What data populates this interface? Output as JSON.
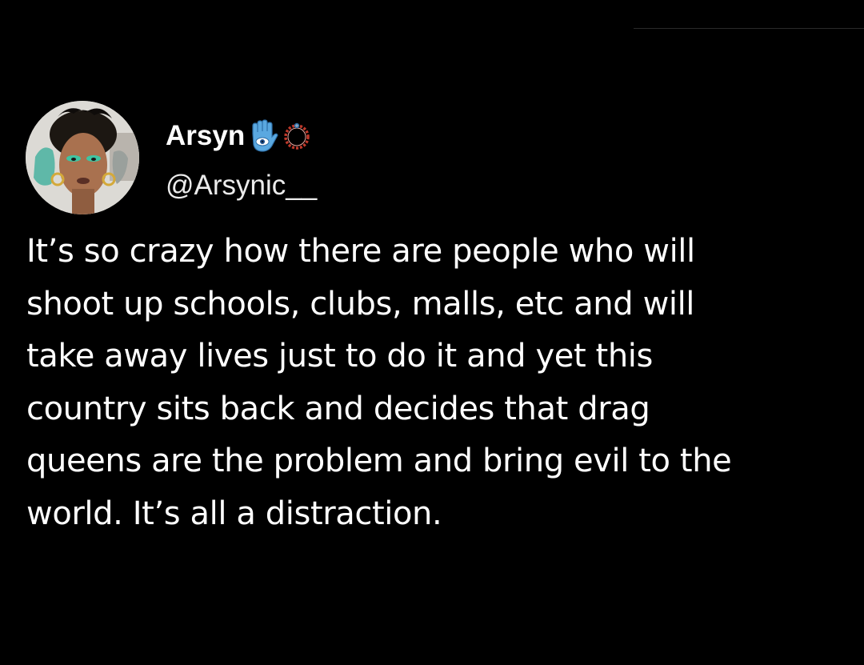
{
  "tweet": {
    "display_name": "Arsyn",
    "handle": "@Arsynic__",
    "name_badges": [
      "hamsa-icon",
      "nazar-bracelet-icon"
    ],
    "text_lines": [
      "It’s so crazy how there are people who will",
      "shoot up schools, clubs, malls, etc and will",
      "take away lives just to do it and yet this",
      "country sits back and decides that drag",
      "queens are the problem and bring evil to the",
      "world. It’s all a distraction."
    ]
  },
  "colors": {
    "background": "#000000",
    "text": "#ffffff",
    "hamsa": "#4aa3df",
    "bracelet": "#c0392b"
  }
}
